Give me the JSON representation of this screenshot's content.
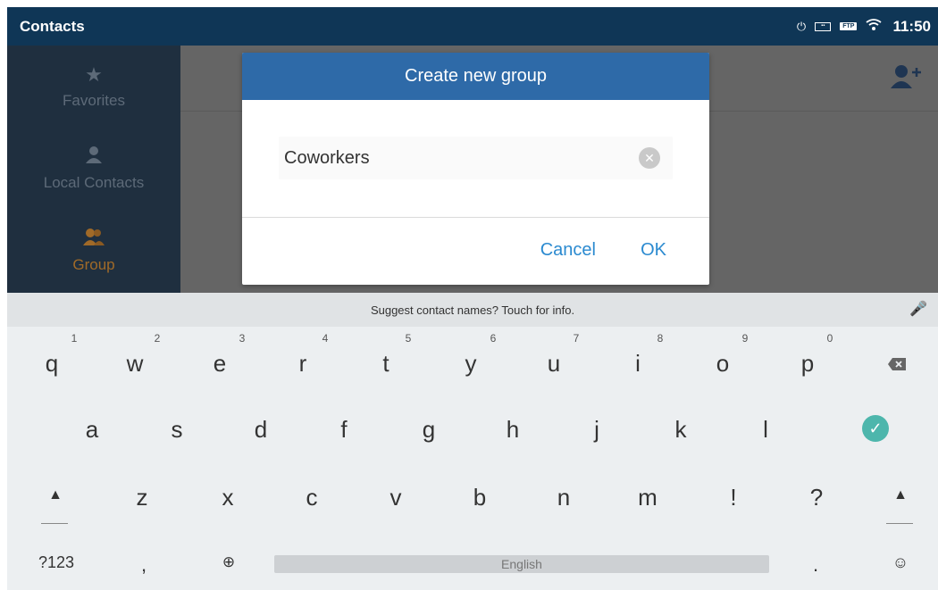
{
  "status_bar": {
    "title": "Contacts",
    "time": "11:50",
    "icons": [
      "poe-icon",
      "usb-icon",
      "ftp-icon",
      "wifi-icon"
    ],
    "ftp_label": "FTP"
  },
  "sidebar": {
    "items": [
      {
        "label": "Favorites",
        "icon": "star-icon"
      },
      {
        "label": "Local Contacts",
        "icon": "person-icon"
      },
      {
        "label": "Group",
        "icon": "group-icon",
        "active": true
      }
    ]
  },
  "dialog": {
    "title": "Create new group",
    "input_value": "Coworkers",
    "cancel_label": "Cancel",
    "ok_label": "OK"
  },
  "keyboard": {
    "suggestion": "Suggest contact names? Touch for info.",
    "row1": [
      {
        "k": "q",
        "h": "1"
      },
      {
        "k": "w",
        "h": "2"
      },
      {
        "k": "e",
        "h": "3"
      },
      {
        "k": "r",
        "h": "4"
      },
      {
        "k": "t",
        "h": "5"
      },
      {
        "k": "y",
        "h": "6"
      },
      {
        "k": "u",
        "h": "7"
      },
      {
        "k": "i",
        "h": "8"
      },
      {
        "k": "o",
        "h": "9"
      },
      {
        "k": "p",
        "h": "0"
      }
    ],
    "row2": [
      "a",
      "s",
      "d",
      "f",
      "g",
      "h",
      "j",
      "k",
      "l"
    ],
    "row3": [
      "z",
      "x",
      "c",
      "v",
      "b",
      "n",
      "m",
      "!",
      "?"
    ],
    "symbols_label": "?123",
    "comma": ",",
    "space_label": "English",
    "period": ".",
    "colors": {
      "accent": "#2b8ad0",
      "header": "#2e6aa8",
      "status": "#0f3656",
      "done": "#4db6ac"
    }
  }
}
